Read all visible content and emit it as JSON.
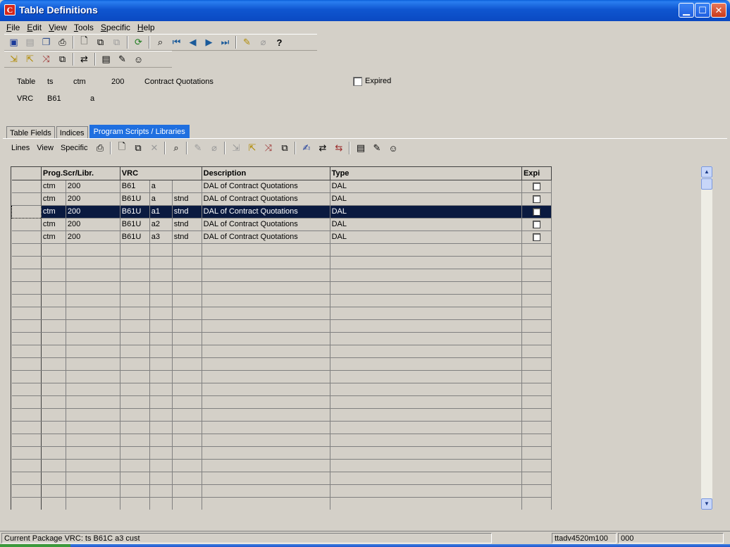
{
  "window": {
    "title": "Table Definitions",
    "app_icon_letter": "C"
  },
  "menu": [
    "File",
    "Edit",
    "View",
    "Tools",
    "Specific",
    "Help"
  ],
  "toolbar1_icons": [
    "save-icon",
    "disk-icon",
    "copy-form-icon",
    "print-icon",
    "new-icon",
    "duplicate-icon",
    "paste-icon",
    "refresh-icon",
    "find-icon",
    "first-record-icon",
    "previous-record-icon",
    "next-record-icon",
    "last-record-icon",
    "edit-note-icon",
    "attach-icon",
    "help-icon"
  ],
  "toolbar2_icons": [
    "import-icon",
    "export-icon",
    "convert-icon",
    "copy-objects-icon",
    "compare-icon",
    "vrc-list-icon",
    "vrc-edit-icon",
    "vrc-user-icon"
  ],
  "header": {
    "table_label": "Table",
    "table_package": "ts",
    "table_module": "ctm",
    "table_number": "200",
    "table_description": "Contract Quotations",
    "vrc_label": "VRC",
    "vrc_version": "B61",
    "vrc_release": "a",
    "expired_label": "Expired"
  },
  "tabs": [
    "Table Fields",
    "Indices",
    "Program Scripts / Libraries"
  ],
  "inner_menu": [
    "Lines",
    "View",
    "Specific"
  ],
  "grid": {
    "headers": [
      "Prog.Scr/Libr.",
      "VRC",
      "Description",
      "Type",
      "Expi"
    ],
    "rows": [
      {
        "mod": "ctm",
        "num": "200",
        "vrc": "B61",
        "rel": "a",
        "cust": "",
        "desc": "DAL of Contract Quotations",
        "type": "DAL"
      },
      {
        "mod": "ctm",
        "num": "200",
        "vrc": "B61U",
        "rel": "a",
        "cust": "stnd",
        "desc": "DAL of Contract Quotations",
        "type": "DAL"
      },
      {
        "mod": "ctm",
        "num": "200",
        "vrc": "B61U",
        "rel": "a1",
        "cust": "stnd",
        "desc": "DAL of Contract Quotations",
        "type": "DAL"
      },
      {
        "mod": "ctm",
        "num": "200",
        "vrc": "B61U",
        "rel": "a2",
        "cust": "stnd",
        "desc": "DAL of Contract Quotations",
        "type": "DAL"
      },
      {
        "mod": "ctm",
        "num": "200",
        "vrc": "B61U",
        "rel": "a3",
        "cust": "stnd",
        "desc": "DAL of Contract Quotations",
        "type": "DAL"
      }
    ],
    "selected_row": 2,
    "empty_rows": 21
  },
  "status": {
    "message": "Current Package VRC: ts B61C a3 cust",
    "session": "ttadv4520m100",
    "company": "000"
  },
  "colors": {
    "title_bar": "#0a49c2",
    "active_tab": "#1f6fe0",
    "selected_row": "#0a1a40"
  }
}
